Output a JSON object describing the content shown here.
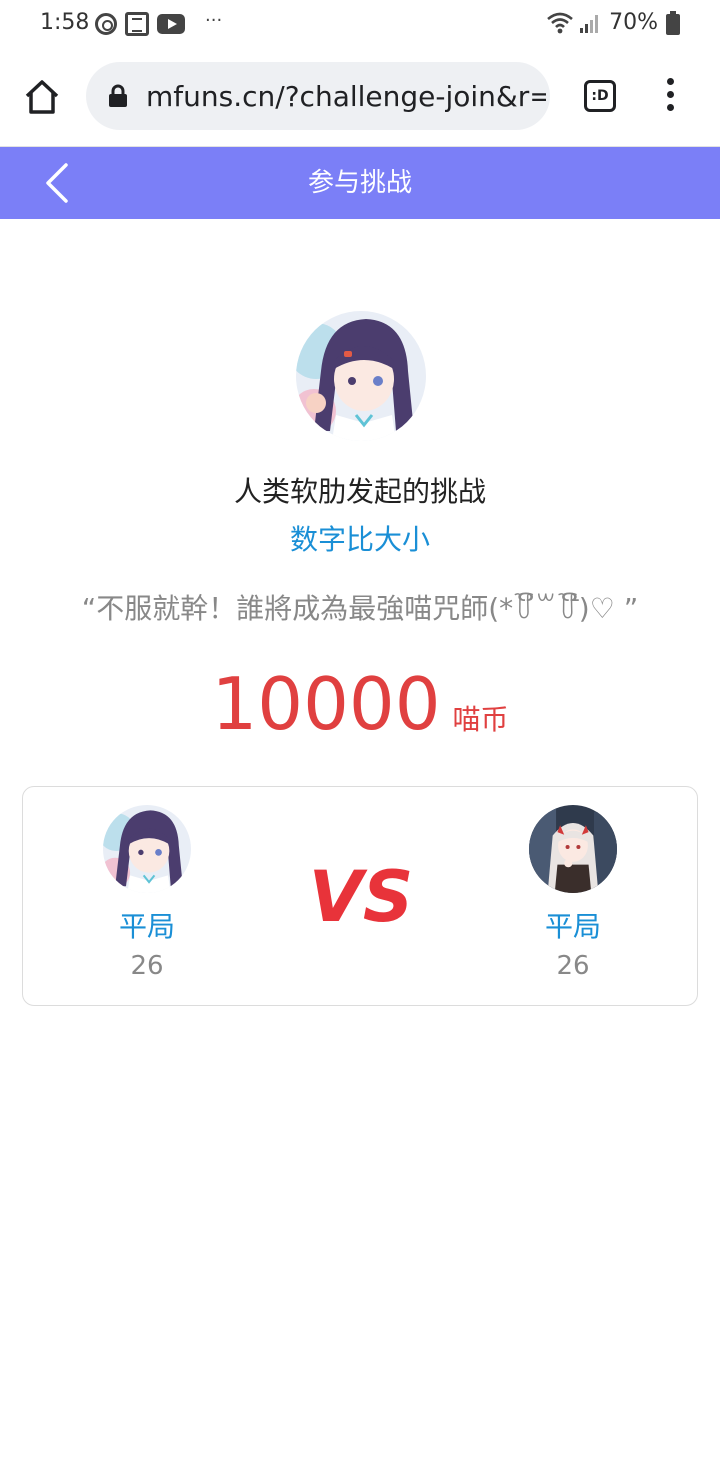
{
  "status_bar": {
    "time": "1:58",
    "more": "···",
    "battery": "70%"
  },
  "browser": {
    "url": "mfuns.cn/?challenge-join&r=",
    "tab_label": ":D"
  },
  "header": {
    "title": "参与挑战",
    "bg_color": "#7b7ff7"
  },
  "challenge": {
    "initiator_line": "人类软肋发起的挑战",
    "game_name": "数字比大小",
    "slogan": "“不服就幹！誰將成為最強喵咒師(*꒦ິ꒳꒦ີ)♡ ”",
    "stake_amount": "10000",
    "stake_unit": "喵币"
  },
  "match": {
    "left": {
      "result": "平局",
      "score": "26"
    },
    "right": {
      "result": "平局",
      "score": "26"
    },
    "vs_label": "VS"
  },
  "colors": {
    "accent": "#7b7ff7",
    "link_blue": "#1a8fd6",
    "stake_red": "#e04040"
  }
}
